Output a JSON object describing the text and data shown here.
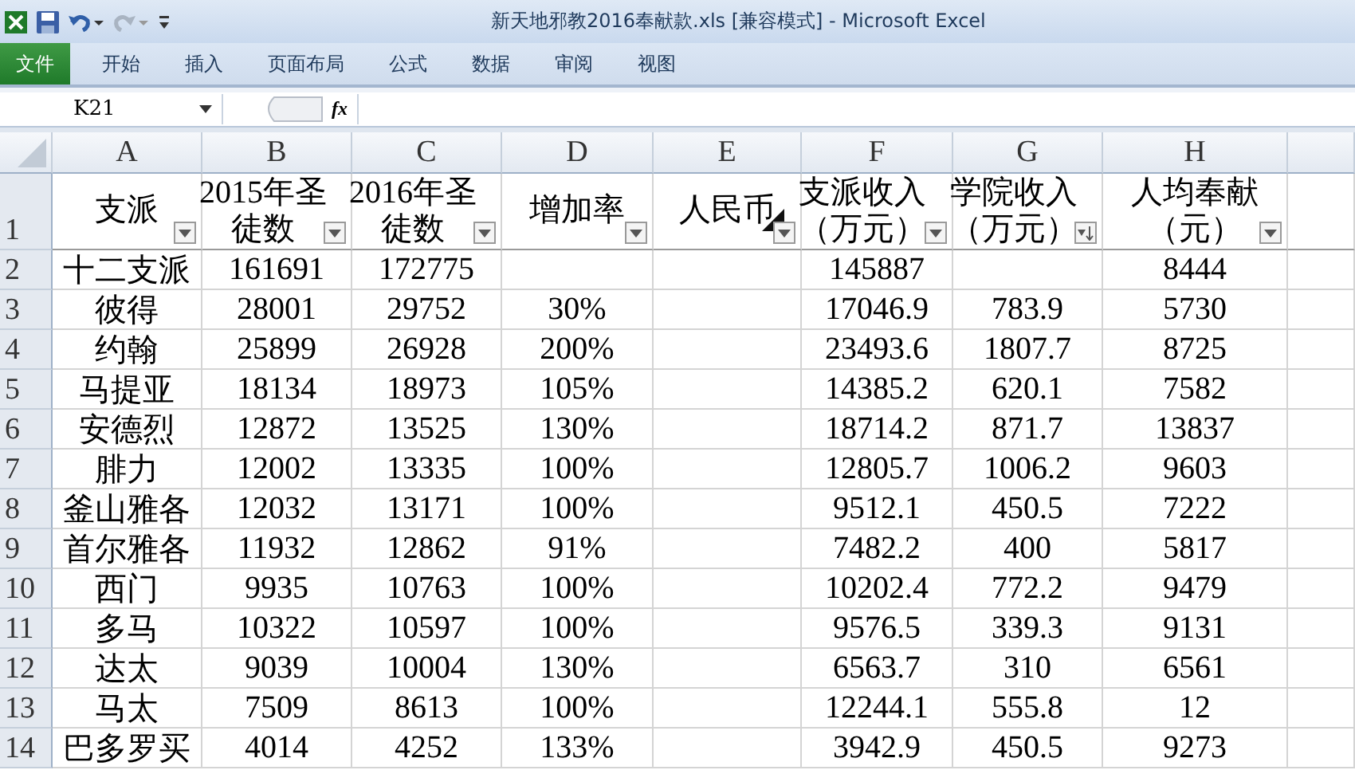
{
  "window": {
    "title": "新天地邪教2016奉献款.xls  [兼容模式]  -  Microsoft Excel"
  },
  "ribbon_tabs": [
    {
      "label": "文件",
      "kind": "file",
      "selected": false
    },
    {
      "label": "开始",
      "kind": "tab",
      "selected": false
    },
    {
      "label": "插入",
      "kind": "tab",
      "selected": false
    },
    {
      "label": "页面布局",
      "kind": "tab",
      "selected": false
    },
    {
      "label": "公式",
      "kind": "tab",
      "selected": false
    },
    {
      "label": "数据",
      "kind": "tab",
      "selected": false
    },
    {
      "label": "审阅",
      "kind": "tab",
      "selected": false
    },
    {
      "label": "视图",
      "kind": "tab",
      "selected": false
    }
  ],
  "formula_bar": {
    "name_box": "K21",
    "fx": "fx"
  },
  "columns": [
    "A",
    "B",
    "C",
    "D",
    "E",
    "F",
    "G",
    "H"
  ],
  "header_row": {
    "row": "1",
    "cells": [
      {
        "lines": [
          "支派"
        ],
        "sorted": false,
        "comment": false
      },
      {
        "lines": [
          "2015年圣",
          "徒数"
        ],
        "sorted": false,
        "comment": false
      },
      {
        "lines": [
          "2016年圣",
          "徒数"
        ],
        "sorted": false,
        "comment": false
      },
      {
        "lines": [
          "增加率"
        ],
        "sorted": false,
        "comment": false
      },
      {
        "lines": [
          "人民币"
        ],
        "sorted": false,
        "comment": true
      },
      {
        "lines": [
          "支派收入",
          "（万元）"
        ],
        "sorted": false,
        "comment": false
      },
      {
        "lines": [
          "学院收入",
          "（万元）"
        ],
        "sorted": true,
        "comment": false
      },
      {
        "lines": [
          "人均奉献",
          "（元）"
        ],
        "sorted": false,
        "comment": false
      }
    ]
  },
  "rows": [
    {
      "row": "2",
      "cells": [
        "十二支派",
        "161691",
        "172775",
        null,
        null,
        "145887",
        null,
        "8444"
      ]
    },
    {
      "row": "3",
      "cells": [
        "彼得",
        "28001",
        "29752",
        "30%",
        null,
        "17046.9",
        "783.9",
        "5730"
      ]
    },
    {
      "row": "4",
      "cells": [
        "约翰",
        "25899",
        "26928",
        "200%",
        null,
        "23493.6",
        "1807.7",
        "8725"
      ]
    },
    {
      "row": "5",
      "cells": [
        "马提亚",
        "18134",
        "18973",
        "105%",
        null,
        "14385.2",
        "620.1",
        "7582"
      ]
    },
    {
      "row": "6",
      "cells": [
        "安德烈",
        "12872",
        "13525",
        "130%",
        null,
        "18714.2",
        "871.7",
        "13837"
      ]
    },
    {
      "row": "7",
      "cells": [
        "腓力",
        "12002",
        "13335",
        "100%",
        null,
        "12805.7",
        "1006.2",
        "9603"
      ]
    },
    {
      "row": "8",
      "cells": [
        "釜山雅各",
        "12032",
        "13171",
        "100%",
        null,
        "9512.1",
        "450.5",
        "7222"
      ]
    },
    {
      "row": "9",
      "cells": [
        "首尔雅各",
        "11932",
        "12862",
        "91%",
        null,
        "7482.2",
        "400",
        "5817"
      ]
    },
    {
      "row": "10",
      "cells": [
        "西门",
        "9935",
        "10763",
        "100%",
        null,
        "10202.4",
        "772.2",
        "9479"
      ]
    },
    {
      "row": "11",
      "cells": [
        "多马",
        "10322",
        "10597",
        "100%",
        null,
        "9576.5",
        "339.3",
        "9131"
      ]
    },
    {
      "row": "12",
      "cells": [
        "达太",
        "9039",
        "10004",
        "130%",
        null,
        "6563.7",
        "310",
        "6561"
      ]
    },
    {
      "row": "13",
      "cells": [
        "马太",
        "7509",
        "8613",
        "100%",
        null,
        "12244.1",
        "555.8",
        "12"
      ]
    },
    {
      "row": "14",
      "cells": [
        "巴多罗买",
        "4014",
        "4252",
        "133%",
        null,
        "3942.9",
        "450.5",
        "9273"
      ]
    }
  ]
}
